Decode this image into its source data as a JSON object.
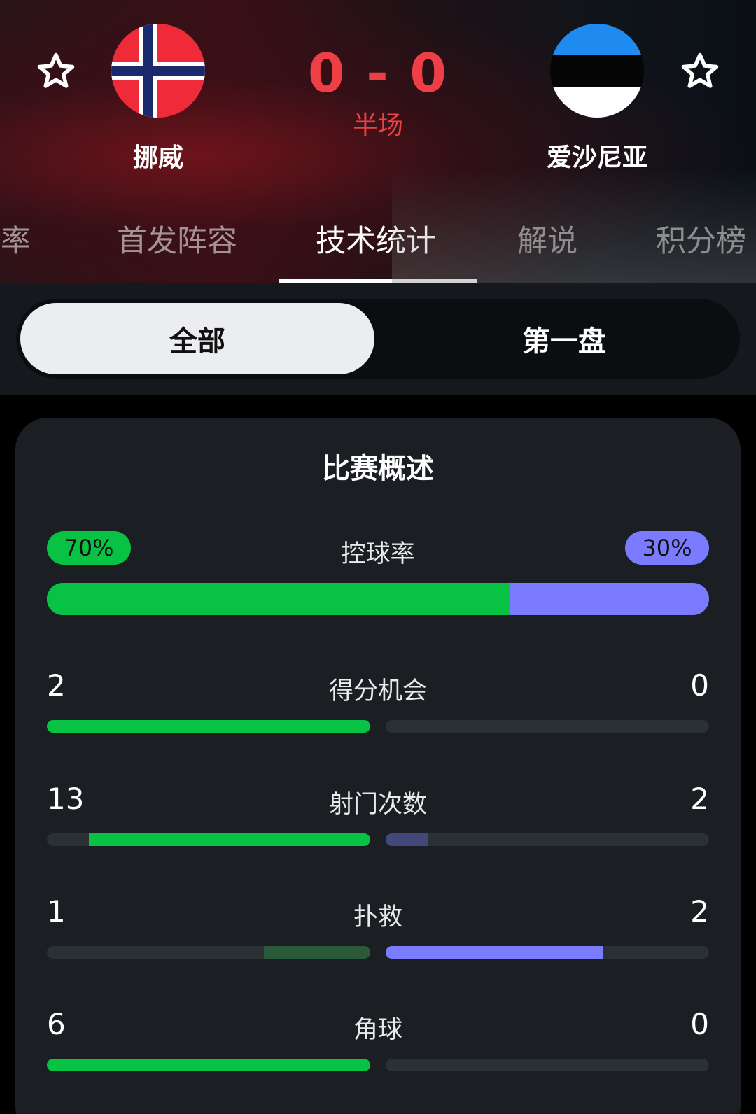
{
  "match": {
    "home_team": "挪威",
    "away_team": "爱沙尼亚",
    "score": "0 - 0",
    "period": "半场"
  },
  "tabs": [
    {
      "label": "赔率"
    },
    {
      "label": "首发阵容"
    },
    {
      "label": "技术统计",
      "active": true
    },
    {
      "label": "解说"
    },
    {
      "label": "积分榜"
    }
  ],
  "segment": {
    "all_label": "全部",
    "first_label": "第一盘",
    "selected": "全部"
  },
  "card": {
    "title": "比赛概述",
    "possession": {
      "label": "控球率",
      "home": "70%",
      "away": "30%",
      "home_fraction": 0.7
    },
    "stats": [
      {
        "label": "得分机会",
        "home": "2",
        "away": "0",
        "home_fraction": 1.0,
        "away_fraction": 0.0,
        "home_strong": true,
        "away_strong": false
      },
      {
        "label": "射门次数",
        "home": "13",
        "away": "2",
        "home_fraction": 0.87,
        "away_fraction": 0.13,
        "home_strong": true,
        "away_strong": false
      },
      {
        "label": "扑救",
        "home": "1",
        "away": "2",
        "home_fraction": 0.33,
        "away_fraction": 0.67,
        "home_strong": false,
        "away_strong": true
      },
      {
        "label": "角球",
        "home": "6",
        "away": "0",
        "home_fraction": 1.0,
        "away_fraction": 0.0,
        "home_strong": true,
        "away_strong": false
      }
    ]
  },
  "colors": {
    "score_red": "#ee3f46",
    "home_green": "#08c244",
    "home_green_dim": "#2a5a3a",
    "away_purple": "#7b7bff",
    "away_purple_dim": "#43477a"
  },
  "icons": [
    "star-outline-icon",
    "norway-flag-icon",
    "estonia-flag-icon"
  ]
}
